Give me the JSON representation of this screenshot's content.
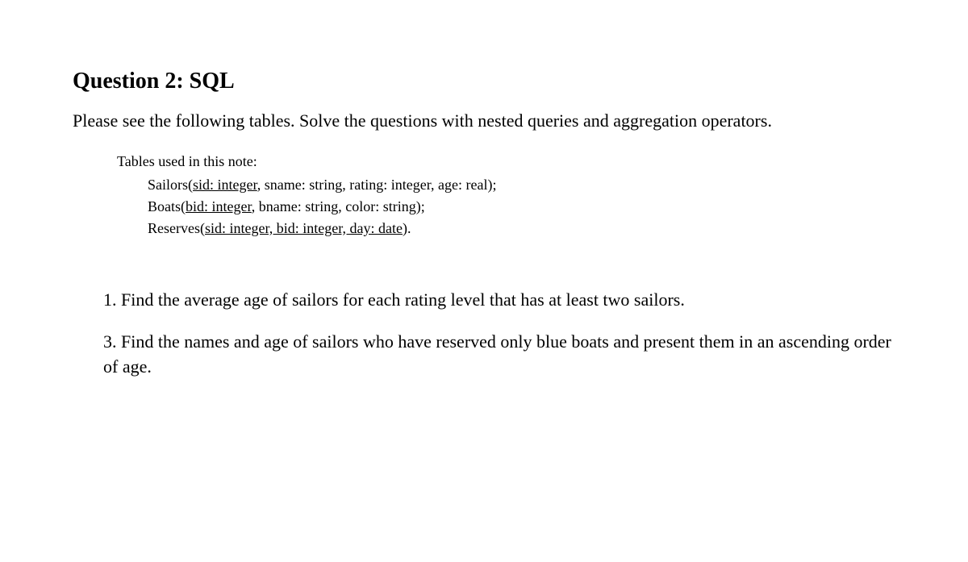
{
  "title": "Question 2: SQL",
  "intro": "Please see the following tables. Solve the questions with nested queries and aggregation operators.",
  "tables": {
    "heading": "Tables used in this note:",
    "defs": [
      {
        "name": "Sailors",
        "key": "sid: integer",
        "rest": ", sname: string, rating: integer, age: real);"
      },
      {
        "name": "Boats",
        "key": "bid: integer",
        "rest": ", bname: string, color: string);"
      },
      {
        "name": "Reserves",
        "key": "sid: integer, bid: integer, day: date",
        "rest": ")."
      }
    ]
  },
  "questions": [
    {
      "number": "1.",
      "text": "Find the average age of sailors for each rating level that has at least two sailors."
    },
    {
      "number": "3.",
      "text": "Find the names and age of sailors who have reserved only blue boats and present them in an ascending order of age."
    }
  ]
}
